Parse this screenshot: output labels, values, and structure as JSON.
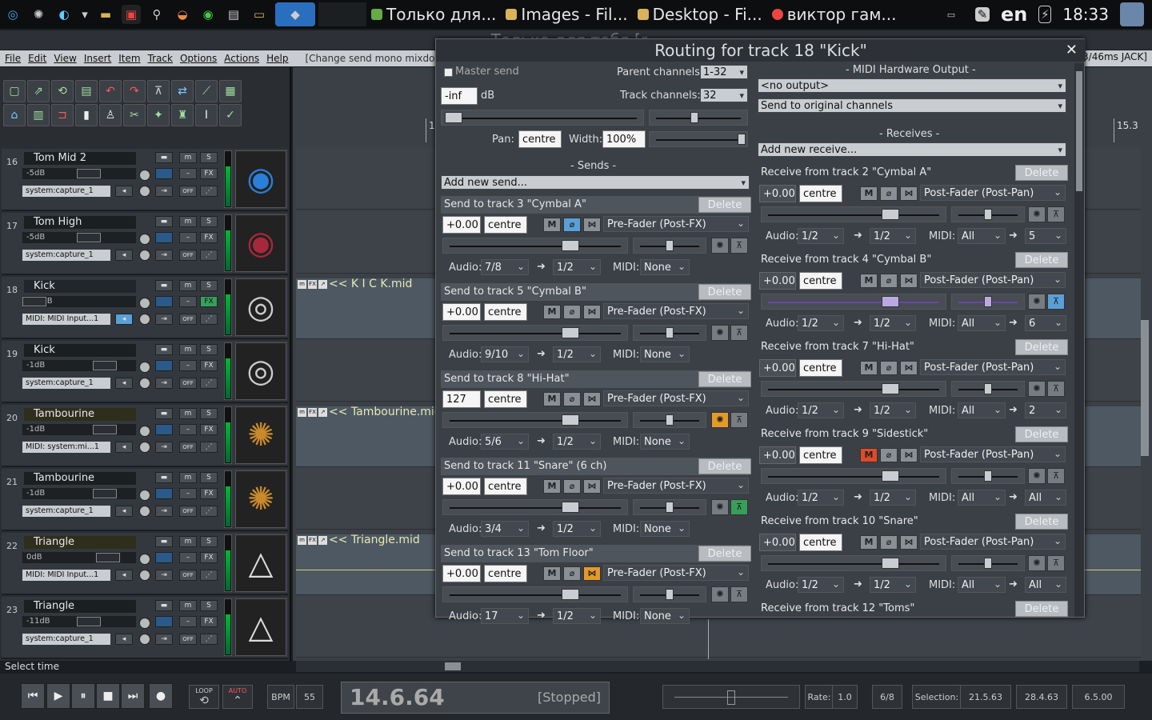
{
  "sysbar": {
    "tasks": [
      "Только для...",
      "Images - Fil...",
      "Desktop - Fi...",
      "виктор гам..."
    ],
    "lang": "en",
    "clock": "18:33"
  },
  "window": {
    "title": "Только для тебя [r...",
    "menus": [
      "File",
      "Edit",
      "View",
      "Insert",
      "Item",
      "Track",
      "Options",
      "Actions",
      "Help"
    ],
    "hint": "[Change send mono mixdown]",
    "jack": "3/46ms JACK]"
  },
  "tracks": [
    {
      "num": "16",
      "name": "Tom Mid 2",
      "vol": "-5dB",
      "input": "system:capture_1",
      "fx": "FX",
      "off": "OFF"
    },
    {
      "num": "17",
      "name": "Tom High",
      "vol": "-5dB",
      "input": "system:capture_1",
      "fx": "FX",
      "off": "OFF"
    },
    {
      "num": "18",
      "name": "Kick",
      "vol": "-inf dB",
      "input": "MIDI: MIDI Input...1",
      "fx": "FX",
      "off": "OFF"
    },
    {
      "num": "19",
      "name": "Kick",
      "vol": "-1dB",
      "input": "system:capture_1",
      "fx": "FX",
      "off": "OFF"
    },
    {
      "num": "20",
      "name": "Tambourine",
      "vol": "-1dB",
      "input": "MIDI: system:mi...1",
      "fx": "FX",
      "off": "OFF"
    },
    {
      "num": "21",
      "name": "Tambourine",
      "vol": "-1dB",
      "input": "system:capture_1",
      "fx": "FX",
      "off": "OFF"
    },
    {
      "num": "22",
      "name": "Triangle",
      "vol": "0dB",
      "input": "MIDI: MIDI Input...1",
      "fx": "FX",
      "off": "OFF"
    },
    {
      "num": "23",
      "name": "Triangle",
      "vol": "-11dB",
      "input": "system:capture_1",
      "fx": "FX",
      "off": "OFF"
    }
  ],
  "items": [
    "<< K I C K.mid",
    "<< Tambourine.mid",
    "<< Triangle.mid"
  ],
  "ruler": {
    "left": "1",
    "right": "15.3"
  },
  "status": "Select time",
  "transport": {
    "loop": "LOOP",
    "auto": "AUTO",
    "bpm_label": "BPM",
    "bpm": "55",
    "time": "14.6.64",
    "state": "[Stopped]",
    "rate_label": "Rate:",
    "rate": "1.0",
    "timesig": "6/8",
    "selection_label": "Selection:",
    "sel_start": "21.5.63",
    "sel_end": "28.4.63",
    "sel_len": "6.5.00"
  },
  "dialog": {
    "title": "Routing for track 18 \"Kick\"",
    "master_send": "Master send",
    "parent_channels_label": "Parent channels:",
    "parent_channels": "1-32",
    "track_channels_label": "Track channels:",
    "track_channels": "32",
    "volume": "-inf",
    "db": "dB",
    "pan_label": "Pan:",
    "pan": "centre",
    "width_label": "Width:",
    "width": "100%",
    "sends_header": "- Sends -",
    "add_send": "Add new send...",
    "midi_hw_header": "- MIDI Hardware Output -",
    "midi_hw_out": "<no output>",
    "midi_hw_channels": "Send to original channels",
    "receives_header": "- Receives -",
    "add_receive": "Add new receive...",
    "delete": "Delete",
    "audio_label": "Audio:",
    "midi_label": "MIDI:",
    "sends": [
      {
        "title": "Send to track 3 \"Cymbal A\"",
        "vol": "+0.00",
        "pan": "centre",
        "mode": "Pre-Fader (Post-FX)",
        "audio_src": "7/8",
        "audio_dst": "1/2",
        "midi": "None"
      },
      {
        "title": "Send to track 5 \"Cymbal B\"",
        "vol": "+0.00",
        "pan": "centre",
        "mode": "Pre-Fader (Post-FX)",
        "audio_src": "9/10",
        "audio_dst": "1/2",
        "midi": "None"
      },
      {
        "title": "Send to track 8 \"Hi-Hat\"",
        "vol": "127",
        "pan": "centre",
        "mode": "Pre-Fader (Post-FX)",
        "audio_src": "5/6",
        "audio_dst": "1/2",
        "midi": "None"
      },
      {
        "title": "Send to track 11 \"Snare\" (6 ch)",
        "vol": "+0.00",
        "pan": "centre",
        "mode": "Pre-Fader (Post-FX)",
        "audio_src": "3/4",
        "audio_dst": "1/2",
        "midi": "None"
      },
      {
        "title": "Send to track 13 \"Tom Floor\"",
        "vol": "+0.00",
        "pan": "centre",
        "mode": "Pre-Fader (Post-FX)",
        "audio_src": "17",
        "audio_dst": "1/2",
        "midi": "None"
      }
    ],
    "receives": [
      {
        "title": "Receive from track 2 \"Cymbal A\"",
        "vol": "+0.00",
        "pan": "centre",
        "mode": "Post-Fader (Post-Pan)",
        "audio_src": "1/2",
        "audio_dst": "1/2",
        "midi_src": "All",
        "midi_dst": "5"
      },
      {
        "title": "Receive from track 4 \"Cymbal B\"",
        "vol": "+0.00",
        "pan": "centre",
        "mode": "Post-Fader (Post-Pan)",
        "audio_src": "1/2",
        "audio_dst": "1/2",
        "midi_src": "All",
        "midi_dst": "6"
      },
      {
        "title": "Receive from track 7 \"Hi-Hat\"",
        "vol": "+0.00",
        "pan": "centre",
        "mode": "Post-Fader (Post-Pan)",
        "audio_src": "1/2",
        "audio_dst": "1/2",
        "midi_src": "All",
        "midi_dst": "2"
      },
      {
        "title": "Receive from track 9 \"Sidestick\"",
        "vol": "+0.00",
        "pan": "centre",
        "mode": "Post-Fader (Post-Pan)",
        "audio_src": "1/2",
        "audio_dst": "1/2",
        "midi_src": "All",
        "midi_dst": "All"
      },
      {
        "title": "Receive from track 10 \"Snare\"",
        "vol": "+0.00",
        "pan": "centre",
        "mode": "Post-Fader (Post-Pan)",
        "audio_src": "1/2",
        "audio_dst": "1/2",
        "midi_src": "All",
        "midi_dst": "All"
      },
      {
        "title": "Receive from track 12 \"Toms\""
      }
    ]
  }
}
